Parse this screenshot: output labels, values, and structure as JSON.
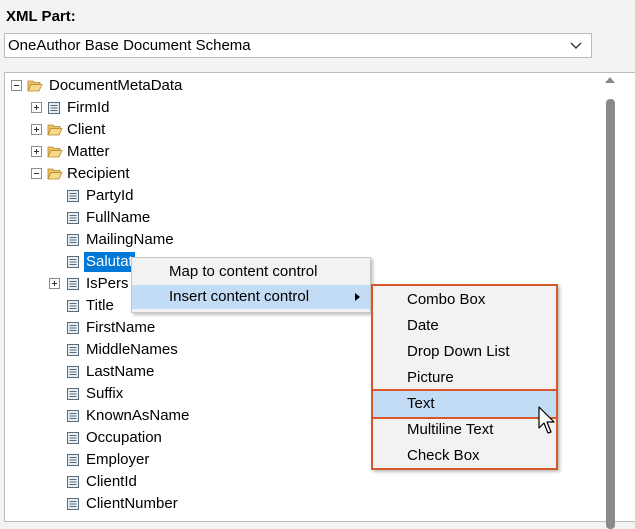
{
  "header": {
    "xml_part_label": "XML Part:"
  },
  "xml_part_select": {
    "value": "OneAuthor Base Document Schema"
  },
  "tree": {
    "root": "DocumentMetaData",
    "groups": [
      "FirmId",
      "Client",
      "Matter"
    ],
    "recipient": "Recipient",
    "recipient_children": [
      "PartyId",
      "FullName",
      "MailingName"
    ],
    "selected": "Salutat",
    "is_person": "IsPers",
    "more_children": [
      "Title",
      "FirstName",
      "MiddleNames",
      "LastName",
      "Suffix",
      "KnownAsName",
      "Occupation",
      "Employer",
      "ClientId",
      "ClientNumber"
    ]
  },
  "context_menu": {
    "items": [
      "Map to content control",
      "Insert content control"
    ]
  },
  "submenu": {
    "items": [
      "Combo Box",
      "Date",
      "Drop Down List",
      "Picture",
      "Text",
      "Multiline Text",
      "Check Box"
    ],
    "highlighted": "Text"
  },
  "colors": {
    "accent": "#d4582a",
    "selection": "#0078d7",
    "hover": "#c3dcf5"
  }
}
